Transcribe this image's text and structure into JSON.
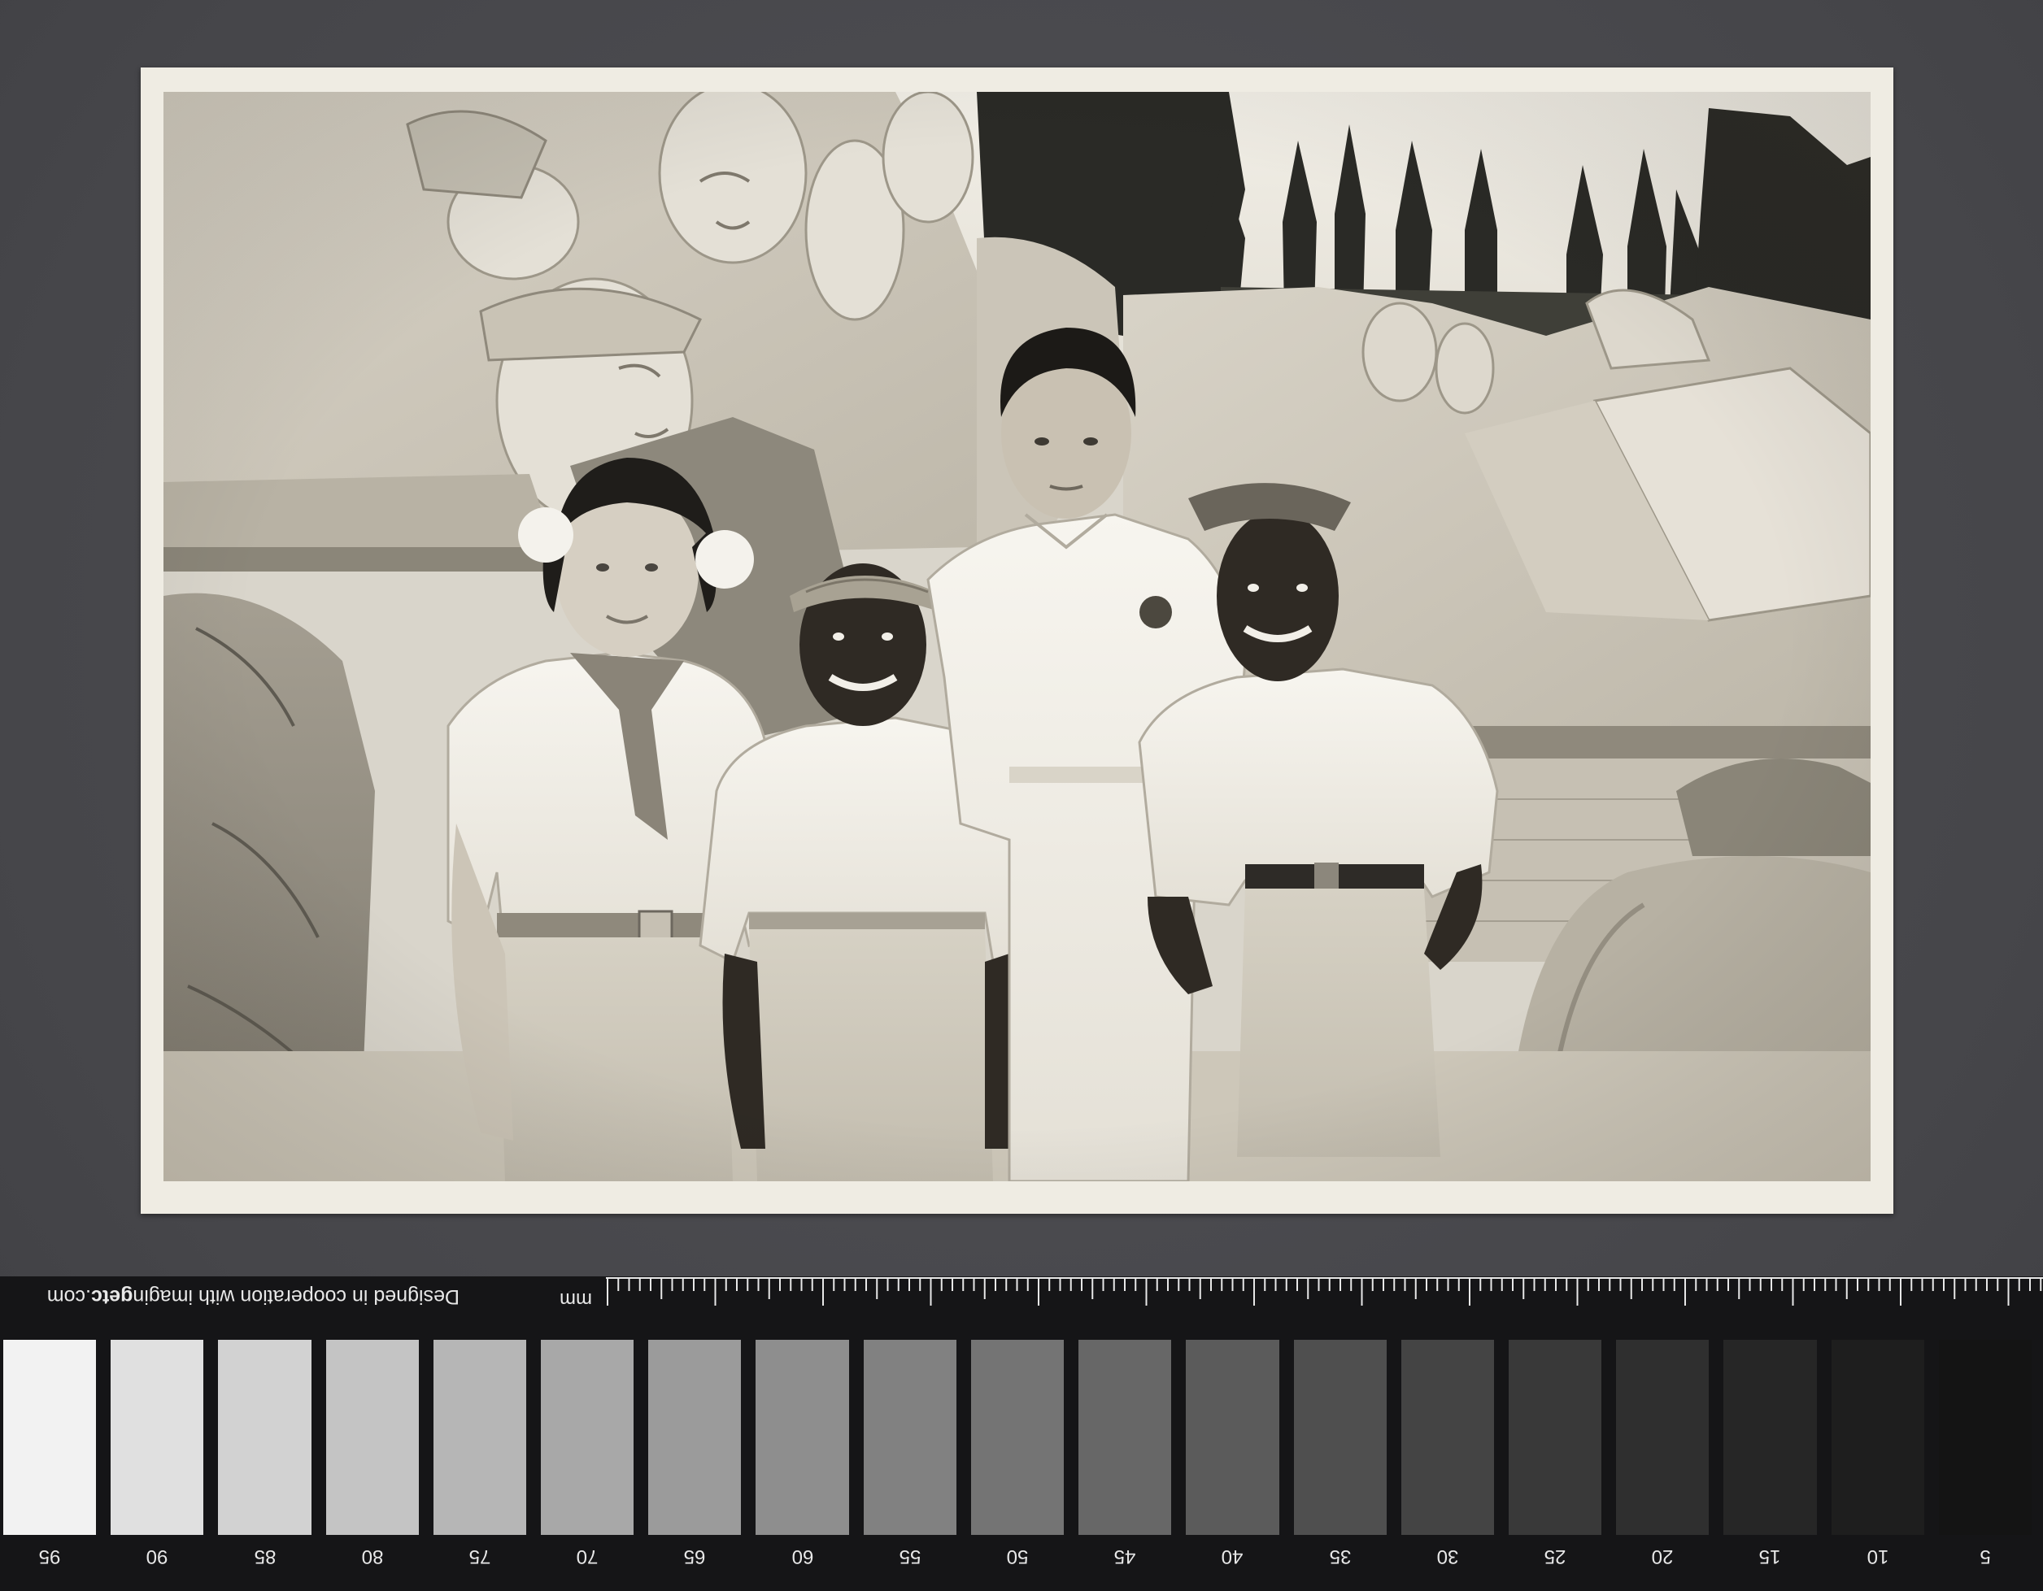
{
  "photo": {
    "subject": "black-and-white photograph of four people in front of a carved stone monument"
  },
  "ruler": {
    "unit_label": "mm",
    "credit_prefix": "Designed in cooperation with imagin",
    "credit_bold": "getc",
    "credit_suffix": ".com"
  },
  "swatches": {
    "labels": [
      "95",
      "90",
      "85",
      "80",
      "75",
      "70",
      "65",
      "60",
      "55",
      "50",
      "45",
      "40",
      "35",
      "30",
      "25",
      "20",
      "15",
      "10",
      "5"
    ],
    "tones": [
      "#f2f2f2",
      "#e0e0e0",
      "#d2d2d2",
      "#c4c4c4",
      "#b6b6b6",
      "#a8a8a8",
      "#9b9b9b",
      "#8e8e8e",
      "#818181",
      "#747474",
      "#676767",
      "#5b5b5b",
      "#4f4f4f",
      "#444444",
      "#393939",
      "#2f2f2f",
      "#262626",
      "#1e1e1e",
      "#141414"
    ]
  },
  "colors": {
    "background": "#4a4a4e",
    "photo_border": "#efece3",
    "strip": "#151517"
  }
}
